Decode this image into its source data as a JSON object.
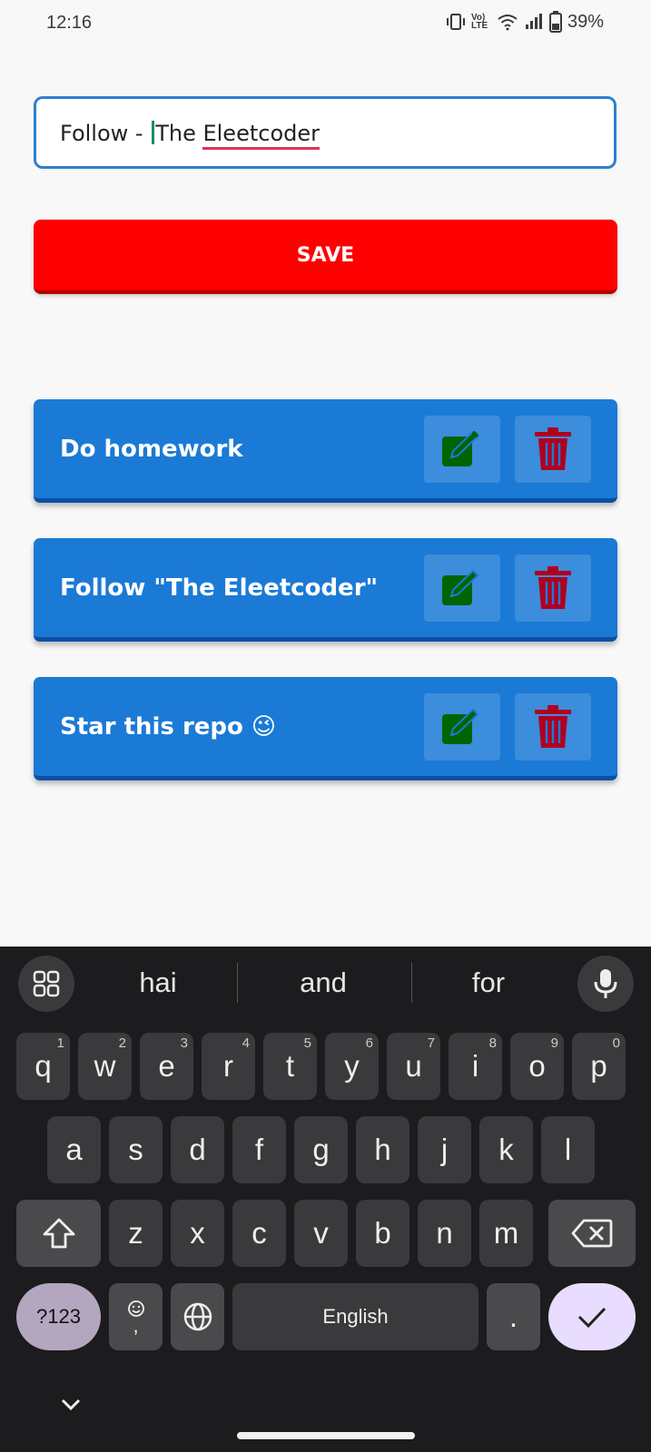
{
  "status": {
    "time": "12:16",
    "battery": "39%",
    "network_label": "Vo) LTE"
  },
  "input": {
    "before_caret": "Follow - ",
    "after_caret": "The ",
    "misspelled": "Eleetcoder"
  },
  "save_label": "SAVE",
  "tasks": [
    {
      "label": "Do homework"
    },
    {
      "label": "Follow \"The Eleetcoder\""
    },
    {
      "label": "Star this repo 😉"
    }
  ],
  "colors": {
    "accent": "#ff0000",
    "card": "#1b7ad6",
    "edit_icon": "#006400",
    "delete_icon": "#b0001f"
  },
  "keyboard": {
    "suggestions": [
      "hai",
      "and",
      "for"
    ],
    "row1": [
      {
        "k": "q",
        "h": "1"
      },
      {
        "k": "w",
        "h": "2"
      },
      {
        "k": "e",
        "h": "3"
      },
      {
        "k": "r",
        "h": "4"
      },
      {
        "k": "t",
        "h": "5"
      },
      {
        "k": "y",
        "h": "6"
      },
      {
        "k": "u",
        "h": "7"
      },
      {
        "k": "i",
        "h": "8"
      },
      {
        "k": "o",
        "h": "9"
      },
      {
        "k": "p",
        "h": "0"
      }
    ],
    "row2": [
      "a",
      "s",
      "d",
      "f",
      "g",
      "h",
      "j",
      "k",
      "l"
    ],
    "row3": [
      "z",
      "x",
      "c",
      "v",
      "b",
      "n",
      "m"
    ],
    "sym_label": "?123",
    "emoji_sub": ",",
    "space_label": "English",
    "period": "."
  }
}
